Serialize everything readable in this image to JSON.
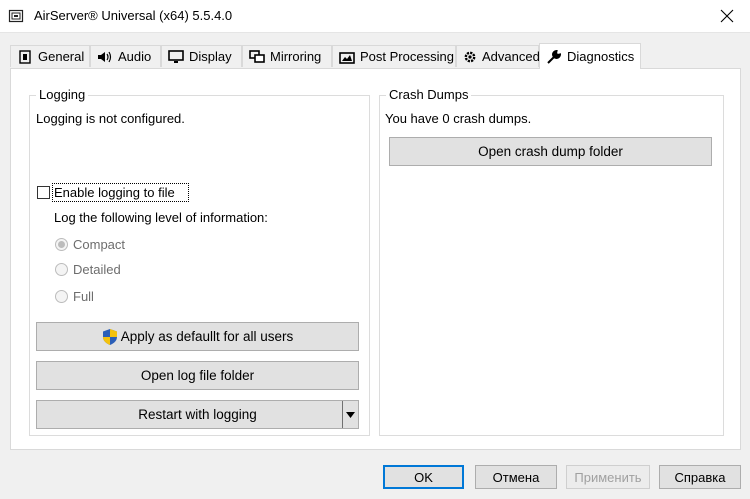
{
  "window": {
    "title": "AirServer® Universal (x64) 5.5.4.0",
    "icon": "airserver-app-icon",
    "close_icon": "close-icon"
  },
  "tabs": [
    {
      "label": "General",
      "icon": "general-icon",
      "active": false
    },
    {
      "label": "Audio",
      "icon": "speaker-icon",
      "active": false
    },
    {
      "label": "Display",
      "icon": "monitor-icon",
      "active": false
    },
    {
      "label": "Mirroring",
      "icon": "mirroring-icon",
      "active": false
    },
    {
      "label": "Post Processing",
      "icon": "post-processing-icon",
      "active": false
    },
    {
      "label": "Advanced",
      "icon": "gear-icon",
      "active": false
    },
    {
      "label": "Diagnostics",
      "icon": "wrench-icon",
      "active": true
    }
  ],
  "logging": {
    "group_title": "Logging",
    "status": "Logging is not configured.",
    "enable_label": "Enable logging to file",
    "enable_checked": false,
    "level_label": "Log the following level of information:",
    "levels": [
      {
        "label": "Compact",
        "selected": true
      },
      {
        "label": "Detailed",
        "selected": false
      },
      {
        "label": "Full",
        "selected": false
      }
    ],
    "apply_default_label": "Apply as defaullt for all users",
    "open_folder_label": "Open log file folder",
    "restart_label": "Restart with logging"
  },
  "crash_dumps": {
    "group_title": "Crash Dumps",
    "status": "You have 0 crash dumps.",
    "open_folder_label": "Open crash dump folder"
  },
  "footer": {
    "ok": "OK",
    "cancel": "Отмена",
    "apply": "Применить",
    "help": "Справка"
  },
  "colors": {
    "accent": "#0078d7",
    "disabled_text": "#a0a0a0",
    "shield_blue": "#2b5fb8",
    "shield_yellow": "#f4c20d"
  }
}
